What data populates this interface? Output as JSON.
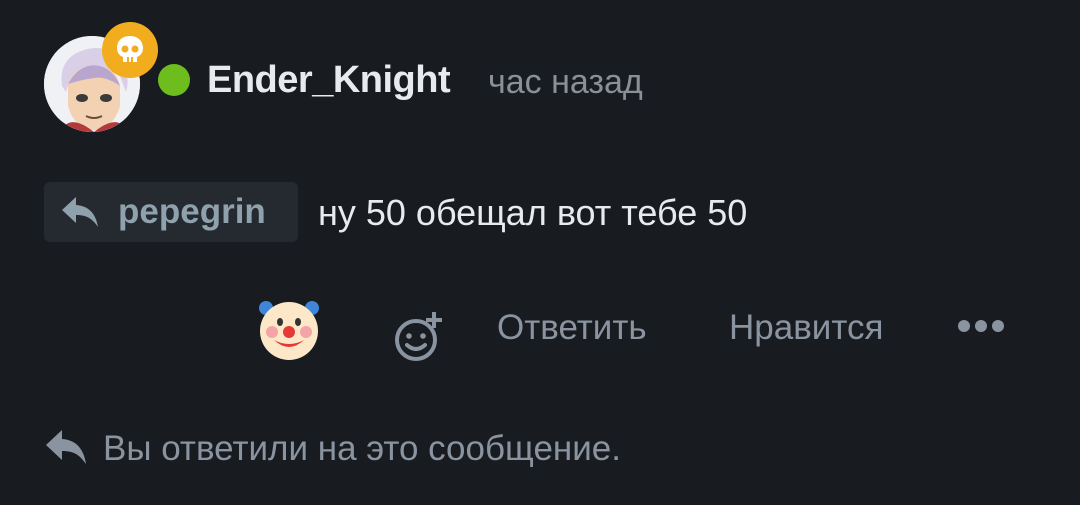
{
  "message": {
    "author": "Ender_Knight",
    "time": "час назад",
    "reply_to": "pepegrin",
    "text": "ну 50 обещал вот тебе 50"
  },
  "actions": {
    "reply": "Ответить",
    "like": "Нравится"
  },
  "footer": {
    "note": "Вы ответили на это сообщение."
  },
  "icons": {
    "avatar": "anime-character-avatar",
    "badge": "skull-icon",
    "status": "online-dot",
    "reply": "reply-arrow-icon",
    "reaction": "clown-emoji",
    "add_reaction": "add-reaction-icon",
    "more": "more-dots-icon"
  },
  "colors": {
    "background": "#181c20",
    "online": "#6cbd1d",
    "badge": "#f2ad1e",
    "muted_text": "#8a94a1"
  }
}
